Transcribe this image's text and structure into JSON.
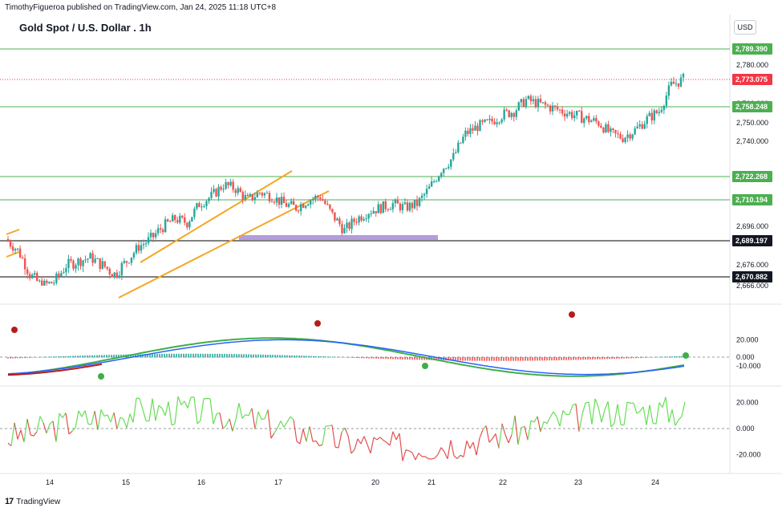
{
  "header": {
    "publisher": "TimothyFigueroa published on TradingView.com, Jan 24, 2025 11:18 UTC+8",
    "title": "Gold Spot / U.S. Dollar . 1h",
    "currency": "USD"
  },
  "footer": {
    "brand": "TradingView",
    "logo_glyph": "17"
  },
  "colors": {
    "up": "#26a69a",
    "down": "#ef5350",
    "support": "#4caf50",
    "level_black": "#000000",
    "channel": "#f5a623",
    "zone": "#b39ddb",
    "wave_green": "#3fae49",
    "wave_blue": "#2962ff",
    "wave_red": "#b71c1c",
    "osc_up": "#66dd55",
    "osc_down": "#e0524f",
    "price_tag": "#f23645"
  },
  "chart_data": [
    {
      "type": "line",
      "name": "price",
      "y_ticks": [
        "2,780.000",
        "2,760.000",
        "2,750.000",
        "2,740.000",
        "2,696.000",
        "2,676.000",
        "2,666.000"
      ],
      "y_ticks_values": [
        2780,
        2760,
        2750,
        2740,
        2696,
        2676,
        2666
      ],
      "levels": [
        {
          "label": "2,789.390",
          "value": 2789.39,
          "color": "#4caf50"
        },
        {
          "label": "2,758.248",
          "value": 2758.248,
          "color": "#4caf50"
        },
        {
          "label": "2,722.268",
          "value": 2722.268,
          "color": "#4caf50"
        },
        {
          "label": "2,710.194",
          "value": 2710.194,
          "color": "#4caf50"
        },
        {
          "label": "2,689.197",
          "value": 2689.197,
          "color": "#000000"
        },
        {
          "label": "2,670.882",
          "value": 2670.882,
          "color": "#000000"
        }
      ],
      "last_price": {
        "label": "2,773.075",
        "value": 2773.075
      },
      "x_labels": [
        "14",
        "15",
        "16",
        "17",
        "20",
        "21",
        "22",
        "23",
        "24"
      ],
      "series": [
        2690,
        2684,
        2672,
        2666,
        2668,
        2676,
        2678,
        2680,
        2676,
        2672,
        2678,
        2686,
        2690,
        2696,
        2700,
        2698,
        2708,
        2712,
        2718,
        2716,
        2710,
        2714,
        2712,
        2708,
        2706,
        2710,
        2712,
        2702,
        2694,
        2700,
        2704,
        2706,
        2708,
        2706,
        2708,
        2716,
        2726,
        2732,
        2744,
        2748,
        2750,
        2754,
        2756,
        2762,
        2760,
        2758,
        2756,
        2754,
        2752,
        2750,
        2744,
        2742,
        2746,
        2752,
        2756,
        2770,
        2773
      ]
    },
    {
      "type": "area",
      "name": "wave oscillator",
      "y_ticks": [
        "20.000",
        "0.000",
        "-10.000"
      ],
      "y_ticks_values": [
        20,
        0,
        -10
      ]
    },
    {
      "type": "line",
      "name": "momentum",
      "y_ticks": [
        "20.000",
        "0.000",
        "-20.000"
      ],
      "y_ticks_values": [
        20,
        0,
        -20
      ]
    }
  ]
}
